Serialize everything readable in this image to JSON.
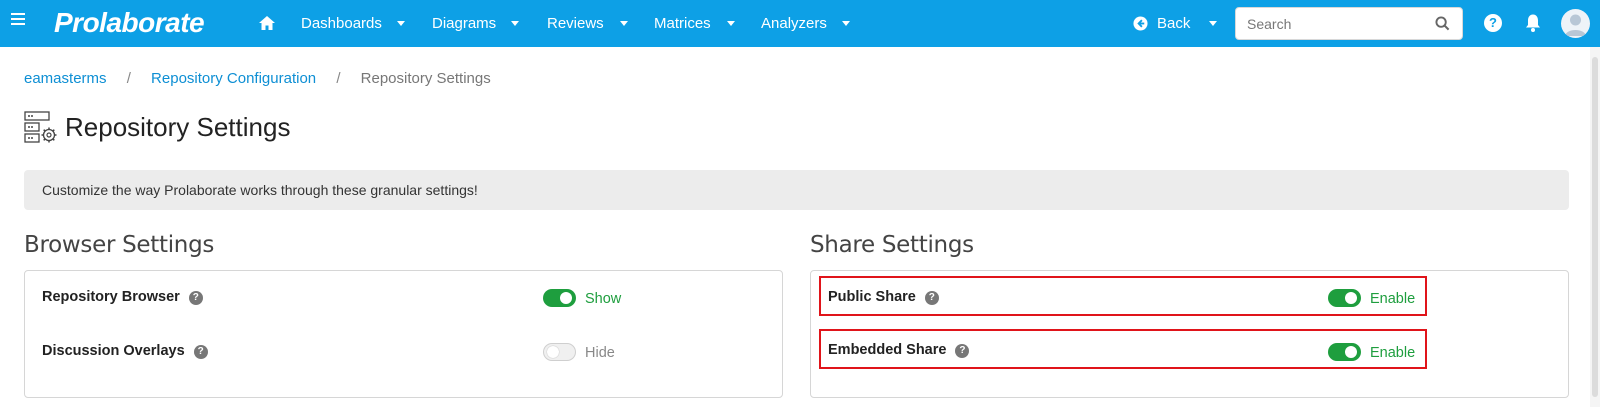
{
  "app": {
    "logo_text": "Prolaborate",
    "brand_color": "#0da0e6"
  },
  "nav": {
    "items": [
      {
        "label": "Dashboards"
      },
      {
        "label": "Diagrams"
      },
      {
        "label": "Reviews"
      },
      {
        "label": "Matrices"
      },
      {
        "label": "Analyzers"
      }
    ],
    "back_label": "Back",
    "search_placeholder": "Search"
  },
  "breadcrumb": {
    "items": [
      "eamasterms",
      "Repository Configuration",
      "Repository Settings"
    ],
    "separator": "/"
  },
  "page": {
    "title": "Repository Settings",
    "banner_text": "Customize the way Prolaborate works through these granular settings!"
  },
  "browser_settings": {
    "title": "Browser Settings",
    "settings": [
      {
        "label": "Repository Browser",
        "state": "on",
        "state_label": "Show"
      },
      {
        "label": "Discussion Overlays",
        "state": "off",
        "state_label": "Hide"
      }
    ]
  },
  "share_settings": {
    "title": "Share Settings",
    "settings": [
      {
        "label": "Public Share",
        "state": "on",
        "state_label": "Enable",
        "highlighted": true
      },
      {
        "label": "Embedded Share",
        "state": "on",
        "state_label": "Enable",
        "highlighted": true
      }
    ]
  },
  "colors": {
    "toggle_on": "#1e9e3e",
    "highlight": "#e0141a",
    "link": "#0e8fd4"
  },
  "icons": {
    "menu": "hamburger-icon",
    "home": "home-icon",
    "back": "back-arrow-icon",
    "search": "search-icon",
    "help": "help-icon",
    "notifications": "bell-icon",
    "user": "avatar-icon",
    "settings_page": "server-settings-icon"
  }
}
